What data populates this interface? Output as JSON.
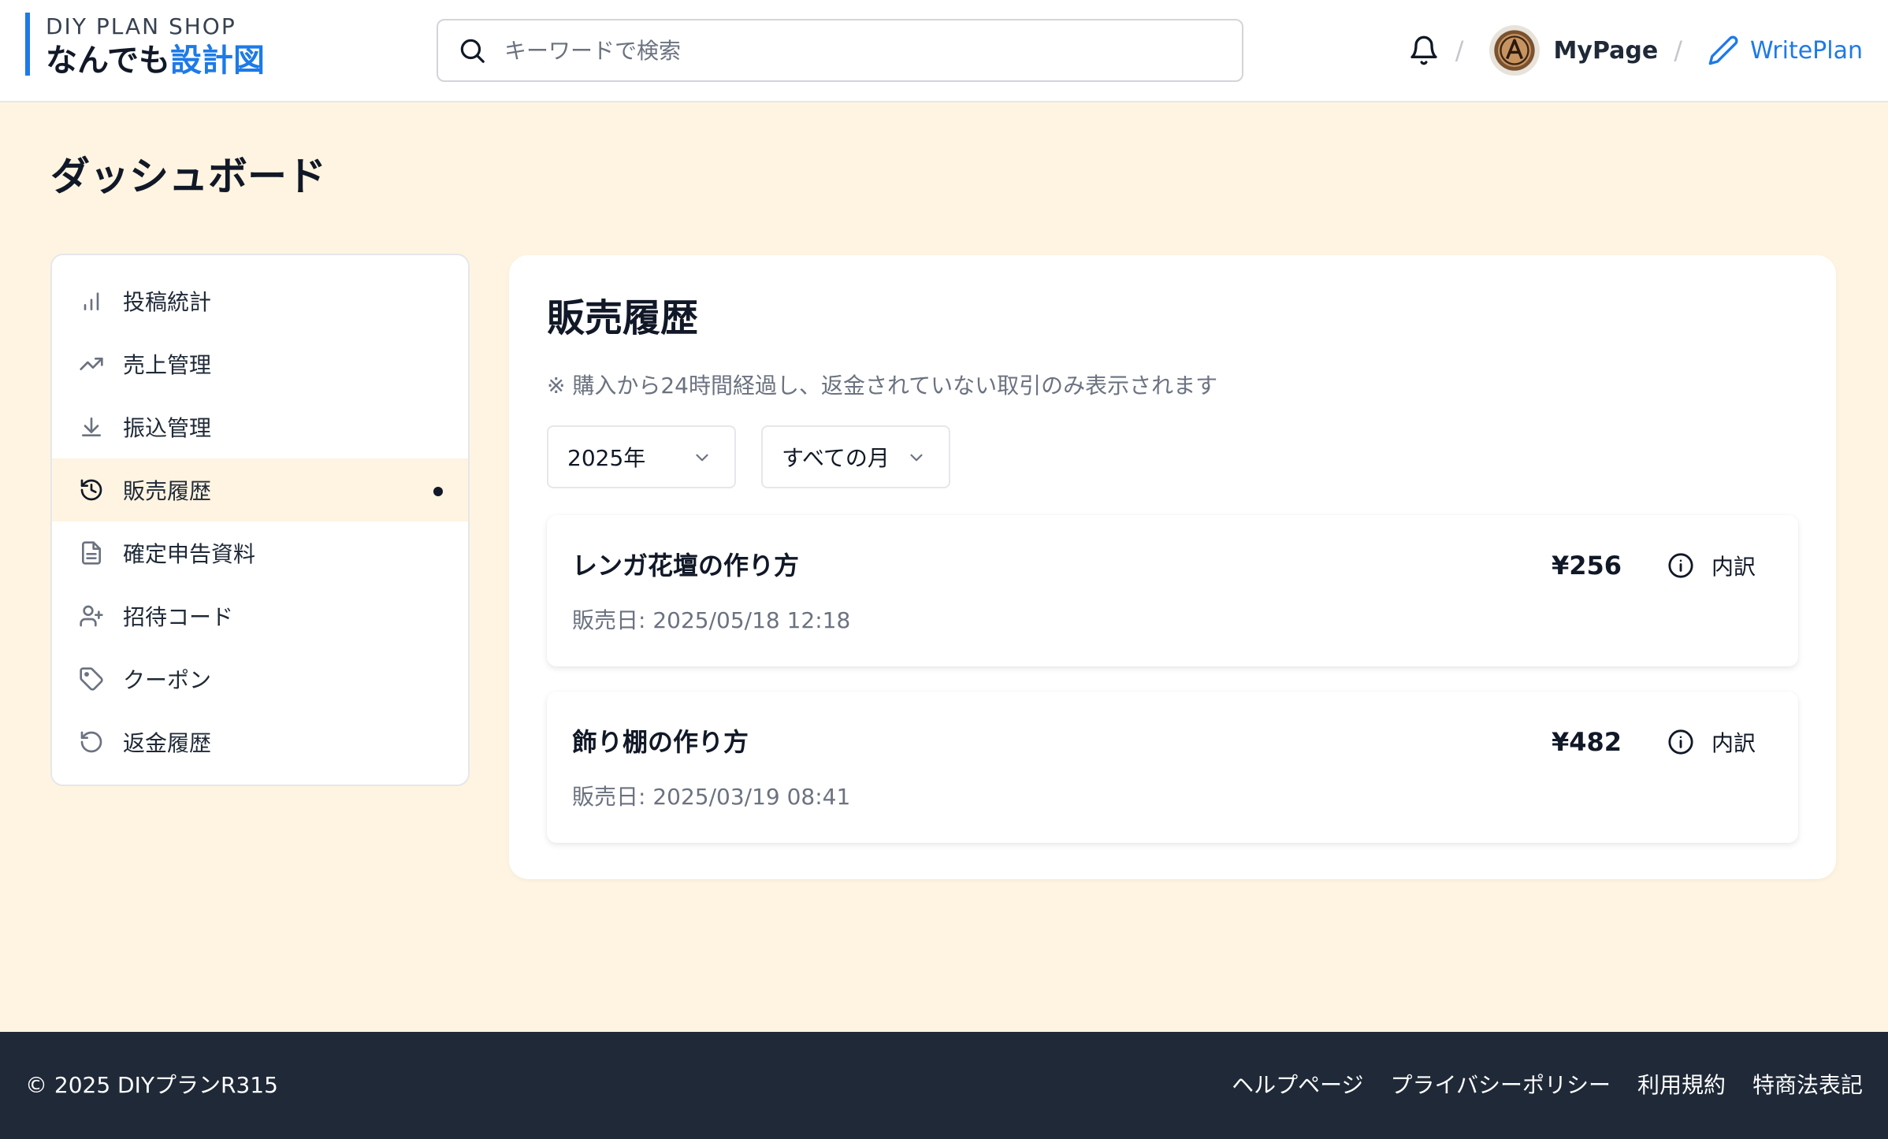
{
  "header": {
    "logo_sub": "DIY PLAN SHOP",
    "logo_main": "なんでも",
    "logo_accent": "設計図",
    "search_placeholder": "キーワードで検索",
    "mypage_label": "MyPage",
    "writeplan_label": "WritePlan",
    "accent_color": "#1d7ae8"
  },
  "page": {
    "title": "ダッシュボード"
  },
  "sidebar": {
    "items": [
      {
        "label": "投稿統計",
        "icon": "bar-chart-icon"
      },
      {
        "label": "売上管理",
        "icon": "trending-up-icon"
      },
      {
        "label": "振込管理",
        "icon": "download-icon"
      },
      {
        "label": "販売履歴",
        "icon": "history-icon",
        "active": true
      },
      {
        "label": "確定申告資料",
        "icon": "document-icon"
      },
      {
        "label": "招待コード",
        "icon": "user-plus-icon"
      },
      {
        "label": "クーポン",
        "icon": "tag-icon"
      },
      {
        "label": "返金履歴",
        "icon": "refresh-icon"
      }
    ]
  },
  "main": {
    "title": "販売履歴",
    "note": "※ 購入から24時間経過し、返金されていない取引のみ表示されます",
    "year_filter": "2025年",
    "month_filter": "すべての月",
    "detail_label": "内訳",
    "sales": [
      {
        "title": "レンガ花壇の作り方",
        "date": "販売日: 2025/05/18 12:18",
        "price": "¥256"
      },
      {
        "title": "飾り棚の作り方",
        "date": "販売日: 2025/03/19 08:41",
        "price": "¥482"
      }
    ]
  },
  "footer": {
    "copyright": "© 2025 DIYプランR315",
    "links": [
      "ヘルプページ",
      "プライバシーポリシー",
      "利用規約",
      "特商法表記"
    ]
  }
}
